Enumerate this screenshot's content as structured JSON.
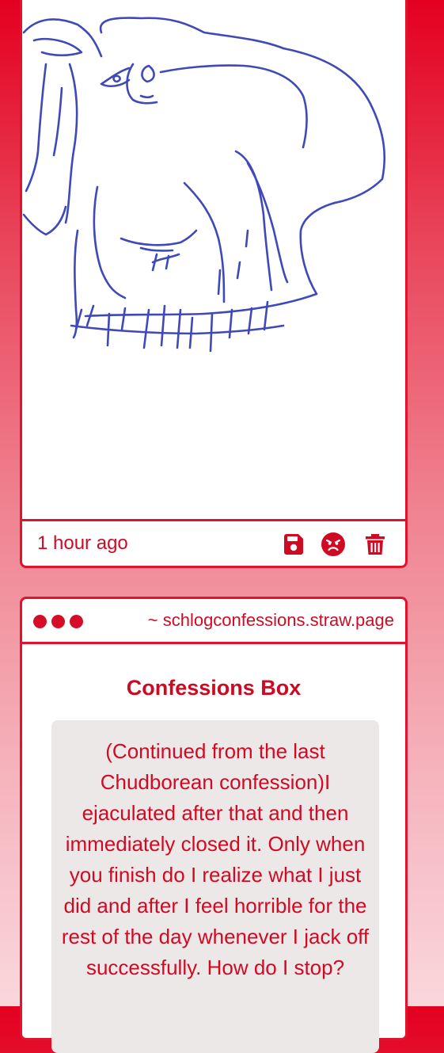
{
  "drawing_post": {
    "drawing_alt": "hand-drawn doodle",
    "timestamp": "1 hour ago",
    "actions": {
      "save_icon": "floppy-disk-icon",
      "react_icon": "angry-face-icon",
      "delete_icon": "trash-icon"
    }
  },
  "confessions_widget": {
    "site_url": "~ schlogconfessions.straw.page",
    "title": "Confessions Box",
    "confession_text": "(Continued from the last Chudborean confession)I ejaculated after that and then immediately closed it. Only when you finish do I realize what I just did and after I feel horrible for the rest of the day whenever I jack off successfully. How do I stop?"
  },
  "colors": {
    "accent": "#e0142e",
    "text_red": "#d10a24",
    "ink_blue": "#3f49b8",
    "box_gray": "#ece8e8"
  }
}
